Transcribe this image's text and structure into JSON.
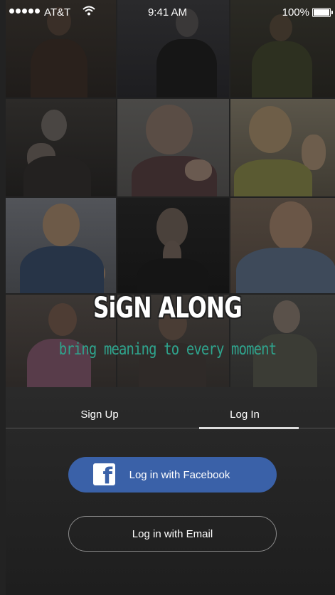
{
  "status_bar": {
    "carrier": "AT&T",
    "time": "9:41 AM",
    "battery": "100%"
  },
  "branding": {
    "logo_text": "SiGN ALONG",
    "tagline": "bring meaning to every moment"
  },
  "tabs": {
    "sign_up": "Sign Up",
    "log_in": "Log In",
    "active": "log_in"
  },
  "buttons": {
    "facebook_label": "Log in with Facebook",
    "facebook_icon": "f",
    "email_label": "Log in with Email"
  },
  "colors": {
    "facebook_blue": "#3a61a8",
    "tagline_teal": "#2fa58e"
  }
}
